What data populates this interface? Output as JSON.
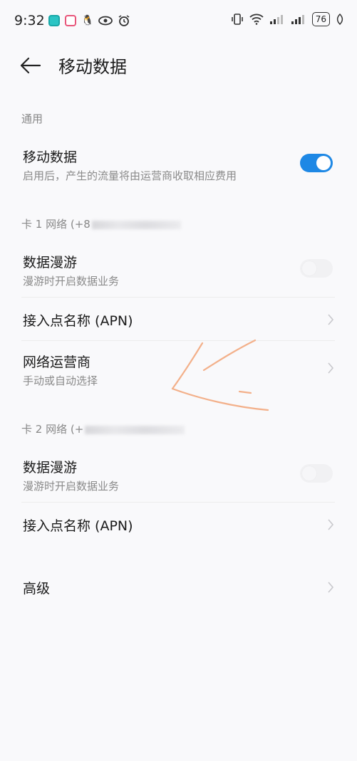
{
  "status_bar": {
    "time": "9:32",
    "battery": "76",
    "icons": [
      "app-teal-icon",
      "app-pink-icon",
      "qq-icon",
      "eye-icon",
      "alarm-icon",
      "vibrate-icon",
      "wifi-icon",
      "signal1-icon",
      "signal2-icon",
      "battery-icon",
      "leaf-icon"
    ]
  },
  "header": {
    "title": "移动数据"
  },
  "general": {
    "section_label": "通用",
    "mobile_data_title": "移动数据",
    "mobile_data_sub": "启用后，产生的流量将由运营商收取相应费用",
    "mobile_data_on": true
  },
  "sim1": {
    "section_label": "卡 1 网络 (+8",
    "roaming_title": "数据漫游",
    "roaming_sub": "漫游时开启数据业务",
    "apn_title": "接入点名称 (APN)",
    "operator_title": "网络运营商",
    "operator_sub": "手动或自动选择"
  },
  "sim2": {
    "section_label": "卡 2 网络 (+",
    "roaming_title": "数据漫游",
    "roaming_sub": "漫游时开启数据业务",
    "apn_title": "接入点名称 (APN)"
  },
  "advanced": {
    "title": "高级"
  },
  "colors": {
    "accent": "#1e88e5",
    "annotation": "#f3b08a"
  }
}
